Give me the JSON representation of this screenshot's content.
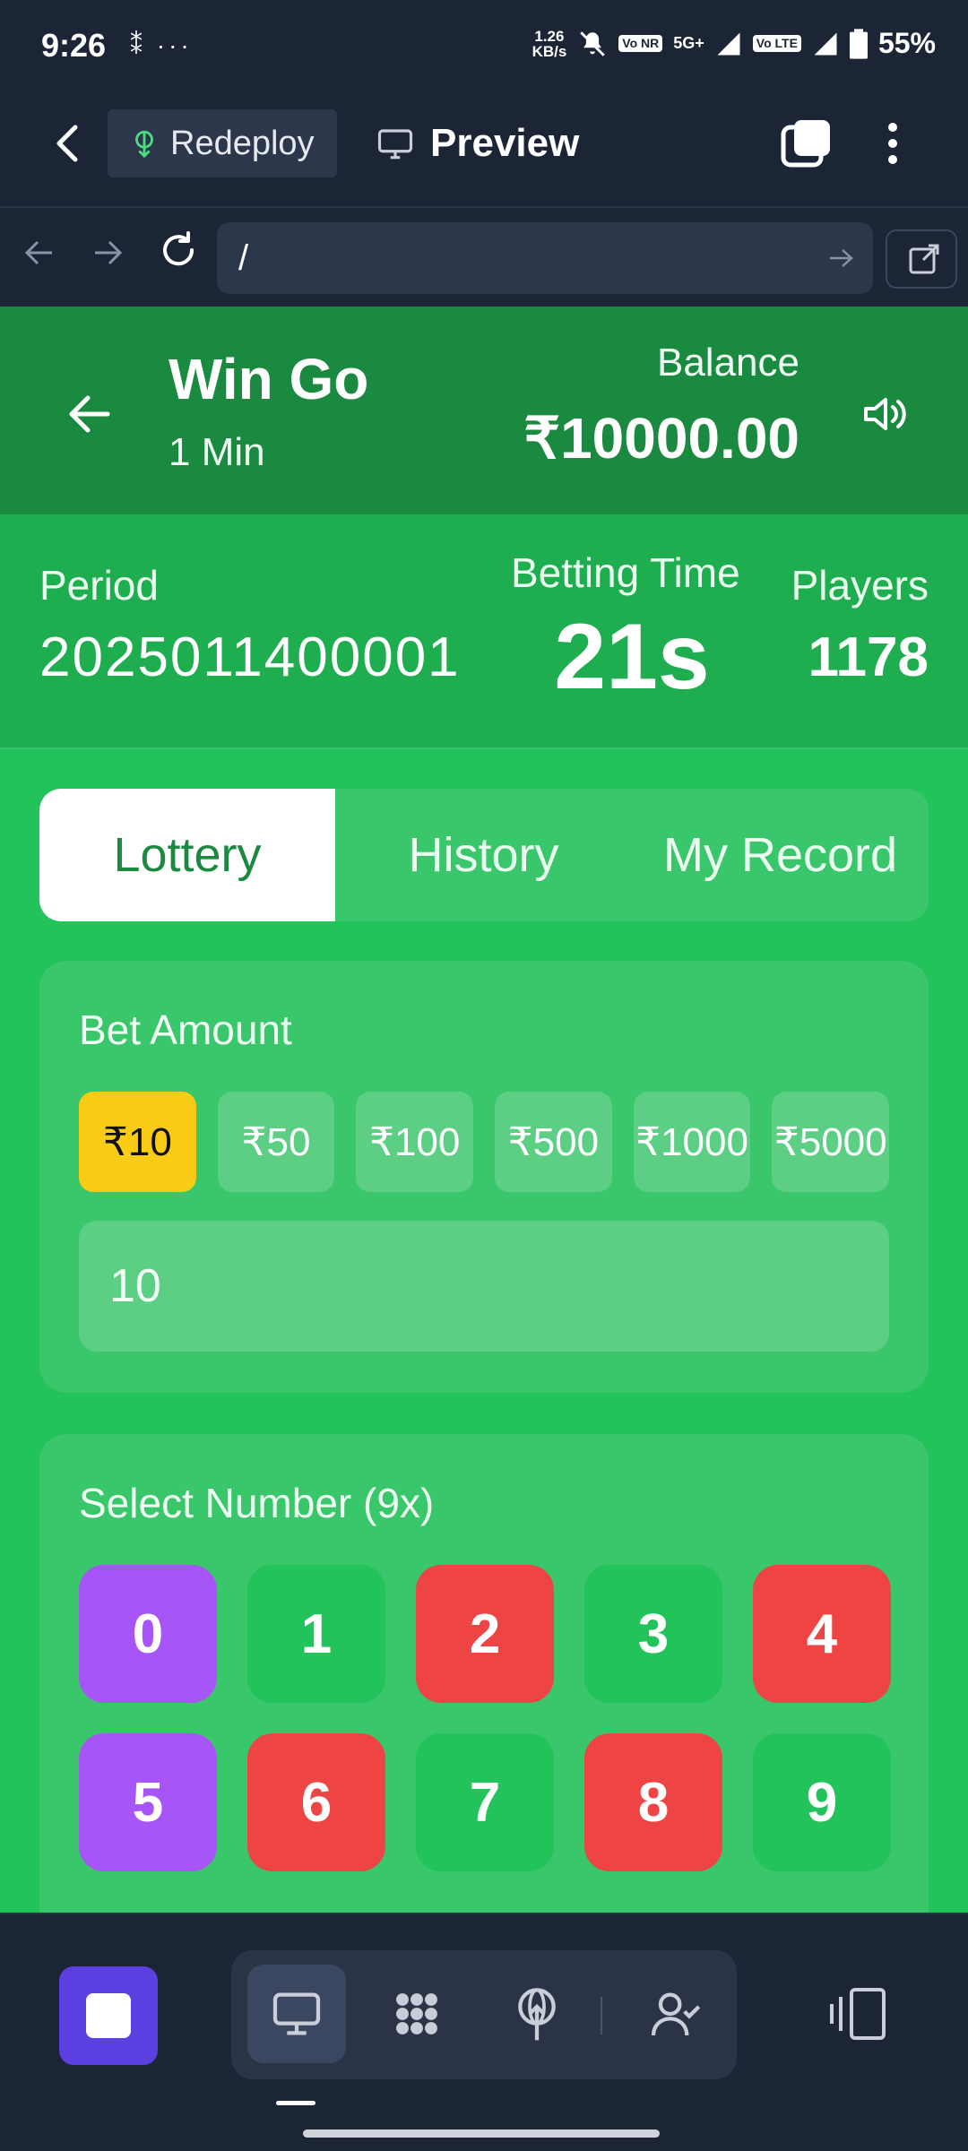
{
  "status_bar": {
    "time": "9:26",
    "left_icons": "⁑ ···",
    "net_speed_top": "1.26",
    "net_speed_bottom": "KB/s",
    "chip_vonr": "Vo NR",
    "network": "5G+",
    "chip_volte": "Vo LTE",
    "battery": "55%"
  },
  "toolbar": {
    "redeploy_label": "Redeploy",
    "preview_label": "Preview"
  },
  "urlbar": {
    "path": "/"
  },
  "header": {
    "title": "Win Go",
    "subtitle": "1 Min",
    "balance_label": "Balance",
    "balance_value": "₹10000.00"
  },
  "round_info": {
    "period_label": "Period",
    "period_value": "2025011400001",
    "betting_time_label": "Betting Time",
    "betting_time_value": "21s",
    "players_label": "Players",
    "players_value": "1178"
  },
  "tabs": [
    {
      "label": "Lottery",
      "active": true
    },
    {
      "label": "History",
      "active": false
    },
    {
      "label": "My Record",
      "active": false
    }
  ],
  "bet_amount": {
    "label": "Bet Amount",
    "options": [
      "₹10",
      "₹50",
      "₹100",
      "₹500",
      "₹1000",
      "₹5000"
    ],
    "selected_index": 0,
    "input_value": "10"
  },
  "select_number": {
    "label": "Select Number (9x)",
    "numbers": [
      "0",
      "1",
      "2",
      "3",
      "4",
      "5",
      "6",
      "7",
      "8",
      "9"
    ]
  },
  "colors": {
    "accent_yellow": "#facc15",
    "violet": "#a855f7",
    "red": "#ef4444",
    "green": "#22c35b",
    "header_green": "#1a8a40"
  }
}
